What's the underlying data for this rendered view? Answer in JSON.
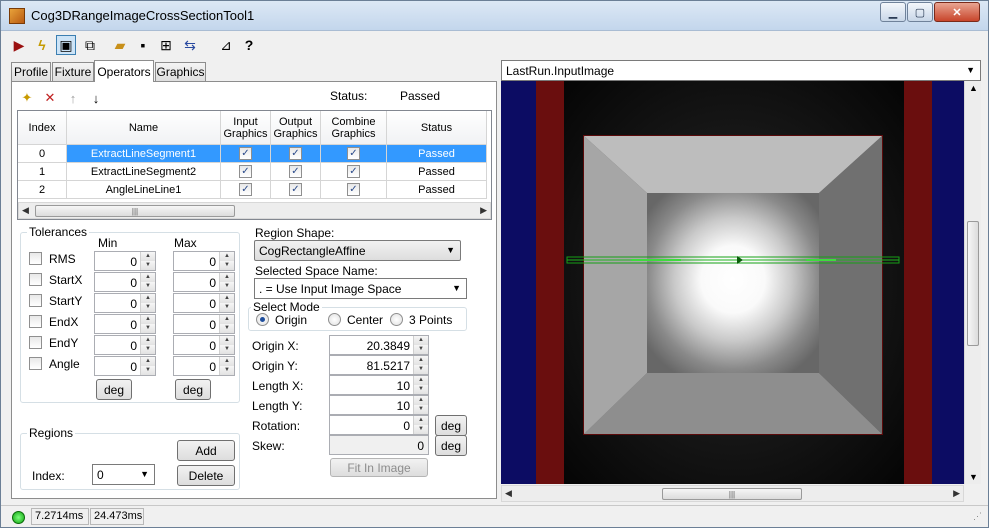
{
  "window": {
    "title": "Cog3DRangeImageCrossSectionTool1"
  },
  "toolbar": {
    "buttons": [
      {
        "name": "run-icon",
        "glyph": "▶",
        "color": "#9a1010"
      },
      {
        "name": "electric-run-icon",
        "glyph": "ϟ",
        "color": "#c59a00"
      },
      {
        "name": "show-display-icon",
        "glyph": "▣",
        "color": "#223"
      },
      {
        "name": "floating-display-icon",
        "glyph": "⧉",
        "color": "#223"
      },
      {
        "name": "open-icon",
        "glyph": "📂",
        "color": "#c8901a"
      },
      {
        "name": "save-icon",
        "glyph": "💾",
        "color": "#223"
      },
      {
        "name": "reset-icon",
        "glyph": "⊞",
        "color": "#223"
      },
      {
        "name": "local-graphics-icon",
        "glyph": "⇆",
        "color": "#2a4aa0"
      },
      {
        "name": "edit-mode-icon",
        "glyph": "⊿",
        "color": "#223"
      },
      {
        "name": "help-icon",
        "glyph": "?",
        "color": "#223"
      }
    ]
  },
  "tabs": [
    "Profile",
    "Fixture",
    "Operators",
    "Graphics"
  ],
  "operators": {
    "status_label": "Status:",
    "status_value": "Passed",
    "icons": [
      {
        "name": "new-icon",
        "glyph": "✦",
        "color": "#c89a00"
      },
      {
        "name": "delete-icon",
        "glyph": "✕",
        "color": "#c02020"
      },
      {
        "name": "move-up-icon",
        "glyph": "↑",
        "color": "#a0a0a0"
      },
      {
        "name": "move-down-icon",
        "glyph": "↓",
        "color": "#000"
      }
    ],
    "columns": [
      "Index",
      "Name",
      "Input Graphics",
      "Output Graphics",
      "Combine Graphics",
      "Status"
    ],
    "rows": [
      {
        "index": "0",
        "name": "ExtractLineSegment1",
        "status": "Passed"
      },
      {
        "index": "1",
        "name": "ExtractLineSegment2",
        "status": "Passed"
      },
      {
        "index": "2",
        "name": "AngleLineLine1",
        "status": "Passed"
      }
    ],
    "check_glyph": "✓"
  },
  "tolerances": {
    "title": "Tolerances",
    "min_label": "Min",
    "max_label": "Max",
    "items": [
      {
        "label": "RMS",
        "min": "0",
        "max": "0"
      },
      {
        "label": "StartX",
        "min": "0",
        "max": "0"
      },
      {
        "label": "StartY",
        "min": "0",
        "max": "0"
      },
      {
        "label": "EndX",
        "min": "0",
        "max": "0"
      },
      {
        "label": "EndY",
        "min": "0",
        "max": "0"
      },
      {
        "label": "Angle",
        "min": "0",
        "max": "0"
      }
    ],
    "deg_label": "deg"
  },
  "regions": {
    "title": "Regions",
    "index_label": "Index:",
    "index_value": "0",
    "add_label": "Add",
    "delete_label": "Delete"
  },
  "region": {
    "shape_label": "Region Shape:",
    "shape_value": "CogRectangleAffine",
    "space_label": "Selected Space Name:",
    "space_value": ". = Use Input Image Space",
    "select_mode_title": "Select Mode",
    "modes": [
      "Origin",
      "Center",
      "3 Points"
    ],
    "fields": [
      {
        "label": "Origin X:",
        "value": "20.3849"
      },
      {
        "label": "Origin Y:",
        "value": "81.5217"
      },
      {
        "label": "Length X:",
        "value": "10"
      },
      {
        "label": "Length Y:",
        "value": "10"
      },
      {
        "label": "Rotation:",
        "value": "0"
      },
      {
        "label": "Skew:",
        "value": "0"
      }
    ],
    "deg_label": "deg",
    "fit_label": "Fit In Image"
  },
  "image": {
    "selector_value": "LastRun.InputImage"
  },
  "status": {
    "time1": "7.2714ms",
    "time2": "24.473ms",
    "ok_color": "#19c219"
  }
}
